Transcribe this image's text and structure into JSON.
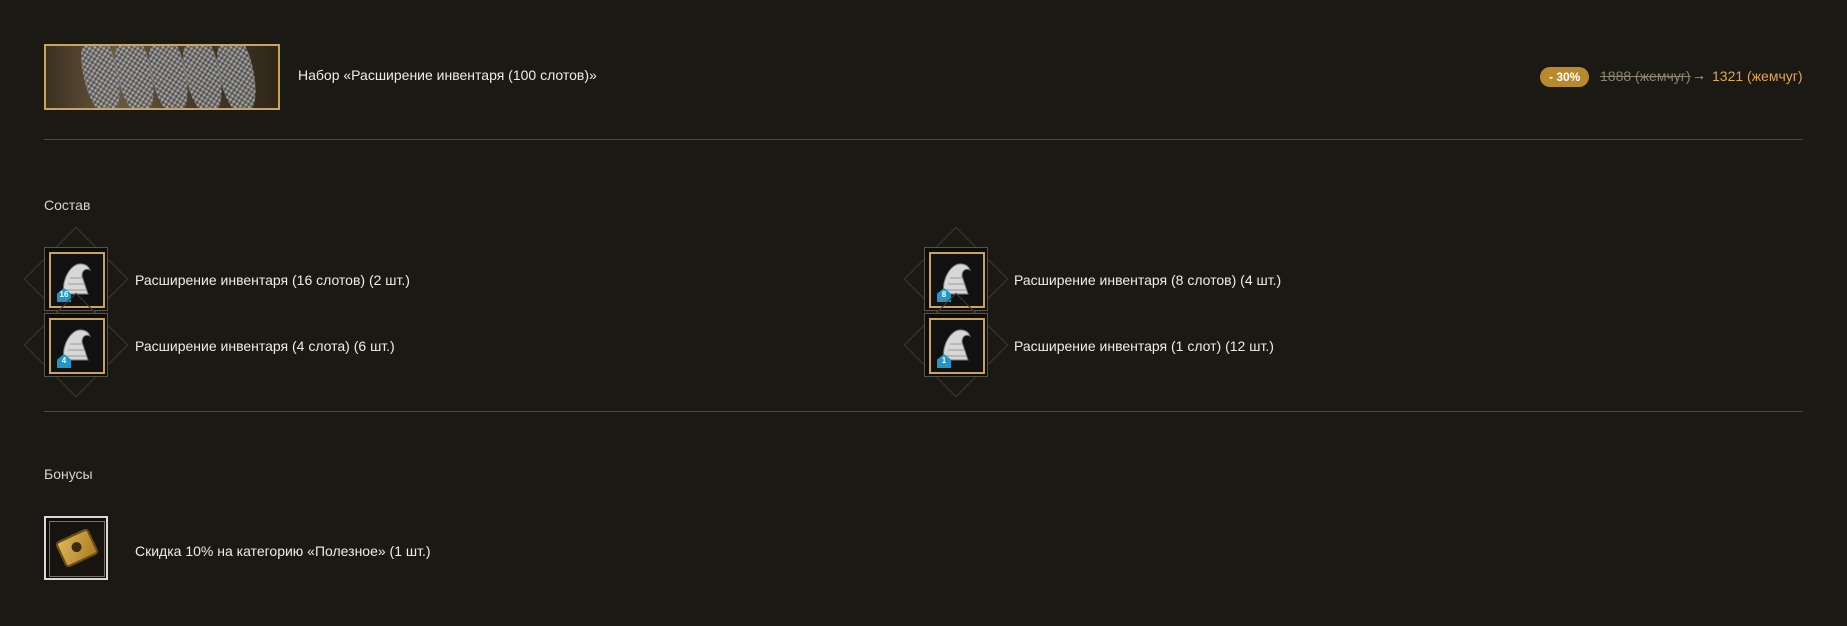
{
  "header": {
    "title": "Набор «Расширение инвентаря (100 слотов)»",
    "discount": "- 30%",
    "old_price": "1888 (жемчуг)",
    "arrow": "→",
    "new_price": "1321 (жемчуг)"
  },
  "composition": {
    "label": "Состав",
    "items": [
      {
        "label": "Расширение инвентаря (16 слотов) (2 шт.)",
        "badge": "16"
      },
      {
        "label": "Расширение инвентаря (8 слотов) (4 шт.)",
        "badge": "8"
      },
      {
        "label": "Расширение инвентаря (4 слота) (6 шт.)",
        "badge": "4"
      },
      {
        "label": "Расширение инвентаря (1 слот) (12 шт.)",
        "badge": "1"
      }
    ]
  },
  "bonuses": {
    "label": "Бонусы",
    "items": [
      {
        "label": "Скидка 10% на категорию «Полезное» (1 шт.)"
      }
    ]
  },
  "colors": {
    "background": "#1a1913",
    "accent_gold": "#c9a45c",
    "price_new": "#e0a74a",
    "discount_badge": "#b98a2c",
    "slot_badge": "#1f97c9"
  }
}
